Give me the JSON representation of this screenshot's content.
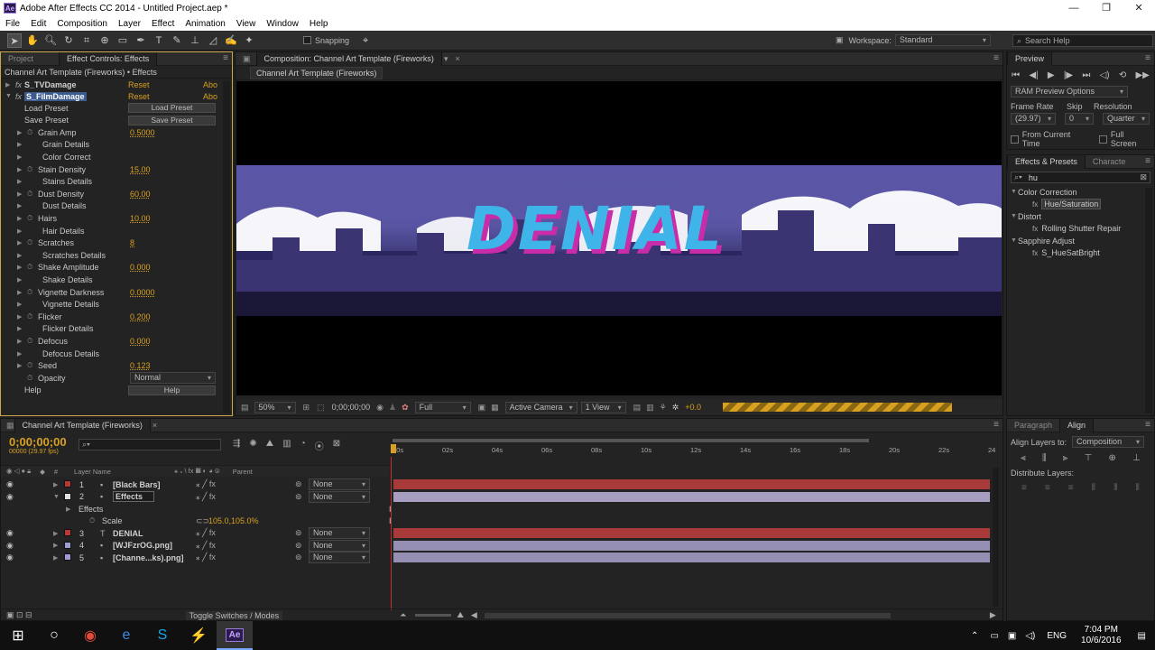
{
  "window": {
    "title": "Adobe After Effects CC 2014 - Untitled Project.aep *",
    "app_badge": "Ae"
  },
  "menu": [
    "File",
    "Edit",
    "Composition",
    "Layer",
    "Effect",
    "Animation",
    "View",
    "Window",
    "Help"
  ],
  "toolbar": {
    "snapping_label": "Snapping",
    "workspace_label": "Workspace:",
    "workspace_value": "Standard",
    "search_placeholder": "Search Help"
  },
  "project_panel": {
    "tabs": [
      "Project",
      "Effect Controls: Effects"
    ],
    "breadcrumb": "Channel Art Template (Fireworks) • Effects",
    "effects": [
      {
        "name": "S_TVDamage",
        "reset": "Reset",
        "about": "Abo"
      },
      {
        "name": "S_FilmDamage",
        "reset": "Reset",
        "about": "Abo"
      }
    ],
    "rows": [
      {
        "label": "Load Preset",
        "button": "Load Preset",
        "indent": 1
      },
      {
        "label": "Save Preset",
        "button": "Save Preset",
        "indent": 1
      },
      {
        "label": "Grain Amp",
        "value": "0.5000",
        "tri": true,
        "stop": true
      },
      {
        "label": "Grain Details",
        "indent": 2,
        "tri": true
      },
      {
        "label": "Color Correct",
        "indent": 2,
        "tri": true
      },
      {
        "label": "Stain Density",
        "value": "15.00",
        "tri": true,
        "stop": true
      },
      {
        "label": "Stains Details",
        "indent": 2,
        "tri": true
      },
      {
        "label": "Dust Density",
        "value": "60.00",
        "tri": true,
        "stop": true
      },
      {
        "label": "Dust Details",
        "indent": 2,
        "tri": true
      },
      {
        "label": "Hairs",
        "value": "10.00",
        "tri": true,
        "stop": true
      },
      {
        "label": "Hair Details",
        "indent": 2,
        "tri": true
      },
      {
        "label": "Scratches",
        "value": "8",
        "tri": true,
        "stop": true
      },
      {
        "label": "Scratches Details",
        "indent": 2,
        "tri": true
      },
      {
        "label": "Shake Amplitude",
        "value": "0.000",
        "tri": true,
        "stop": true
      },
      {
        "label": "Shake Details",
        "indent": 2,
        "tri": true
      },
      {
        "label": "Vignette Darkness",
        "value": "0.0000",
        "tri": true,
        "stop": true
      },
      {
        "label": "Vignette Details",
        "indent": 2,
        "tri": true
      },
      {
        "label": "Flicker",
        "value": "0.200",
        "tri": true,
        "stop": true
      },
      {
        "label": "Flicker Details",
        "indent": 2,
        "tri": true
      },
      {
        "label": "Defocus",
        "value": "0.000",
        "tri": true,
        "stop": true
      },
      {
        "label": "Defocus Details",
        "indent": 2,
        "tri": true
      },
      {
        "label": "Seed",
        "value": "0.123",
        "tri": true,
        "stop": true
      },
      {
        "label": "Opacity",
        "dropdown": "Normal",
        "stop": true
      },
      {
        "label": "Help",
        "button": "Help",
        "indent": 1
      }
    ]
  },
  "composition": {
    "tab": "Composition: Channel Art Template (Fireworks)",
    "subtab": "Channel Art Template (Fireworks)",
    "artwork_text": "DENIAL",
    "footer": {
      "zoom": "50%",
      "timecode": "0;00;00;00",
      "resolution": "Full",
      "camera": "Active Camera",
      "views": "1 View",
      "exposure": "+0.0"
    }
  },
  "preview_panel": {
    "title": "Preview",
    "ram_options": "RAM Preview Options",
    "frame_rate_label": "Frame Rate",
    "skip_label": "Skip",
    "resolution_label": "Resolution",
    "frame_rate": "(29.97)",
    "skip": "0",
    "resolution": "Quarter",
    "from_current": "From Current Time",
    "full_screen": "Full Screen"
  },
  "effects_presets": {
    "tabs": [
      "Effects & Presets",
      "Characte"
    ],
    "search_value": "hu",
    "tree": [
      {
        "label": "Color Correction",
        "type": "folder"
      },
      {
        "label": "Hue/Saturation",
        "type": "effect",
        "selected": true
      },
      {
        "label": "Distort",
        "type": "folder"
      },
      {
        "label": "Rolling Shutter Repair",
        "type": "effect"
      },
      {
        "label": "Sapphire Adjust",
        "type": "folder"
      },
      {
        "label": "S_HueSatBright",
        "type": "effect"
      }
    ]
  },
  "align_panel": {
    "tabs": [
      "Paragraph",
      "Align"
    ],
    "align_to_label": "Align Layers to:",
    "align_to_value": "Composition",
    "distribute_label": "Distribute Layers:"
  },
  "timeline": {
    "tab": "Channel Art Template (Fireworks)",
    "timecode": "0;00;00;00",
    "fps": "00000 (29.97 fps)",
    "search_placeholder": "",
    "col_layer_name": "Layer Name",
    "col_parent": "Parent",
    "ruler": [
      "00s",
      "02s",
      "04s",
      "06s",
      "08s",
      "10s",
      "12s",
      "14s",
      "16s",
      "18s",
      "20s",
      "22s",
      "24"
    ],
    "layers": [
      {
        "num": "1",
        "name": "[Black Bars]",
        "color": "#b73838",
        "parent": "None",
        "bar": "#a83a3a"
      },
      {
        "num": "2",
        "name": "Effects",
        "color": "#e0e0e0",
        "parent": "None",
        "bar": "#a79ec2",
        "expanded": true
      },
      {
        "num": "3",
        "name": "DENIAL",
        "color": "#b73838",
        "parent": "None",
        "bar": "#a83a3a",
        "text": true
      },
      {
        "num": "4",
        "name": "[WJFzrOG.png]",
        "color": "#9d9bd0",
        "parent": "None",
        "bar": "#948fb3"
      },
      {
        "num": "5",
        "name": "[Channe...ks).png]",
        "color": "#9d9bd0",
        "parent": "None",
        "bar": "#948fb3"
      }
    ],
    "sub_effects": "Effects",
    "sub_scale_label": "Scale",
    "sub_scale_value": "105.0,105.0%",
    "toggle_label": "Toggle Switches / Modes"
  },
  "taskbar": {
    "time": "7:04 PM",
    "date": "10/6/2016",
    "lang": "ENG"
  }
}
